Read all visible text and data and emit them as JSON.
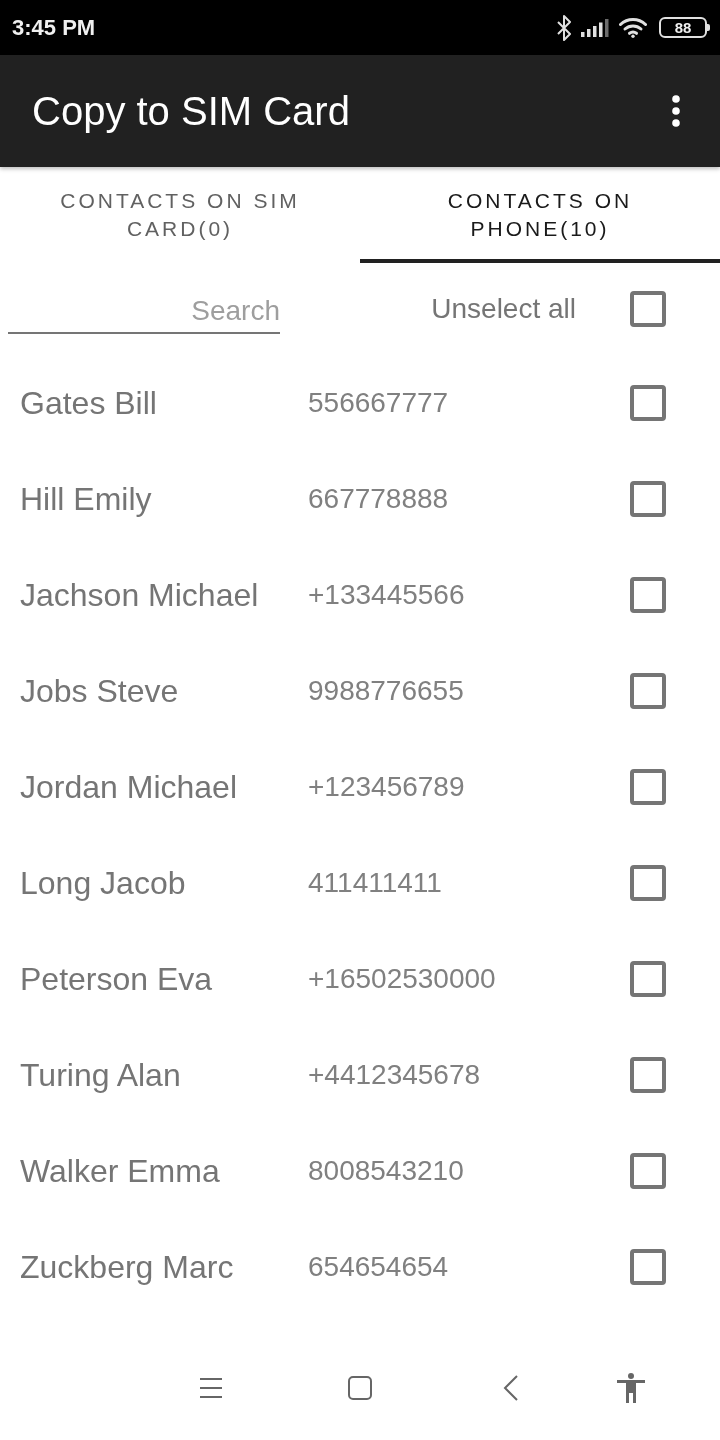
{
  "status_bar": {
    "time": "3:45 PM",
    "battery": "88"
  },
  "app_bar": {
    "title": "Copy to SIM Card"
  },
  "tabs": [
    {
      "label": "CONTACTS ON SIM CARD(0)",
      "selected": false
    },
    {
      "label": "CONTACTS ON PHONE(10)",
      "selected": true
    }
  ],
  "search": {
    "placeholder": "Search"
  },
  "select_all": {
    "label": "Unselect all",
    "checked": false
  },
  "contacts": [
    {
      "name": "Gates Bill",
      "phone": "556667777",
      "checked": false
    },
    {
      "name": "Hill Emily",
      "phone": "667778888",
      "checked": false
    },
    {
      "name": "Jachson Michael",
      "phone": "+133445566",
      "checked": false
    },
    {
      "name": "Jobs Steve",
      "phone": "9988776655",
      "checked": false
    },
    {
      "name": "Jordan Michael",
      "phone": "+123456789",
      "checked": false
    },
    {
      "name": "Long Jacob",
      "phone": "411411411",
      "checked": false
    },
    {
      "name": "Peterson Eva",
      "phone": "+16502530000",
      "checked": false
    },
    {
      "name": "Turing Alan",
      "phone": "+4412345678",
      "checked": false
    },
    {
      "name": "Walker Emma",
      "phone": "8008543210",
      "checked": false
    },
    {
      "name": "Zuckberg Marc",
      "phone": "654654654",
      "checked": false
    }
  ]
}
